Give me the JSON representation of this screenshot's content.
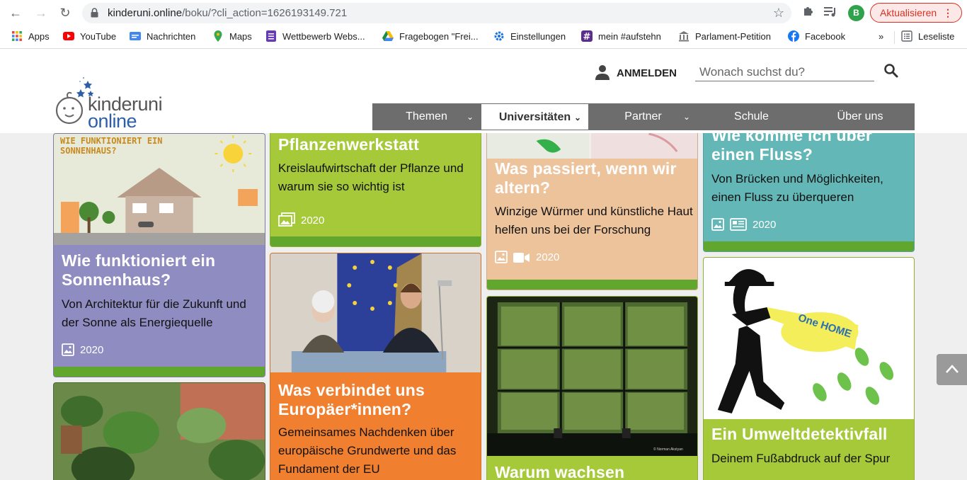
{
  "browser": {
    "url_host": "kinderuni.online",
    "url_path": "/boku/?cli_action=1626193149.721",
    "profile_initial": "B",
    "update_label": "Aktualisieren",
    "bookmarks": [
      {
        "label": "Apps",
        "icon": "apps-grid-icon",
        "color": "#4285f4"
      },
      {
        "label": "YouTube",
        "icon": "youtube-icon",
        "color": "#ff0000"
      },
      {
        "label": "Nachrichten",
        "icon": "google-news-icon",
        "color": "#4285f4"
      },
      {
        "label": "Maps",
        "icon": "maps-pin-icon",
        "color": "#34a853"
      },
      {
        "label": "Wettbewerb Webs...",
        "icon": "forms-icon",
        "color": "#673ab7"
      },
      {
        "label": "Fragebogen \"Frei...",
        "icon": "drive-icon",
        "color": "#fbbc04"
      },
      {
        "label": "Einstellungen",
        "icon": "settings-gear-icon",
        "color": "#1a73e8"
      },
      {
        "label": "mein #aufstehn",
        "icon": "hashtag-icon",
        "color": "#5b2d8f"
      },
      {
        "label": "Parlament-Petition",
        "icon": "parliament-icon",
        "color": "#777777"
      },
      {
        "label": "Facebook",
        "icon": "facebook-icon",
        "color": "#1877f2"
      }
    ],
    "more_label": "»",
    "reading_list_label": "Leseliste"
  },
  "header": {
    "logo_line1": "kinderuni",
    "logo_line2": "online",
    "login_label": "ANMELDEN",
    "search_placeholder": "Wonach suchst du?",
    "nav": [
      {
        "label": "Themen",
        "has_dropdown": true,
        "active": false
      },
      {
        "label": "Universitäten",
        "has_dropdown": true,
        "active": true
      },
      {
        "label": "Partner",
        "has_dropdown": true,
        "active": false
      },
      {
        "label": "Schule",
        "has_dropdown": false,
        "active": false
      },
      {
        "label": "Über uns",
        "has_dropdown": false,
        "active": false
      }
    ]
  },
  "cards": {
    "sonnenhaus": {
      "image_text": "WIE FUNKTIONIERT EIN SONNENHAUS?",
      "title": "Wie funktioniert ein Sonnenhaus?",
      "desc": "Von Architektur für die Zukunft und der Sonne als Energiequelle",
      "year": "2020",
      "color": "#8e8cc0"
    },
    "pflanzen": {
      "title": "Pflanzenwerkstatt",
      "desc": "Kreislaufwirtschaft der Pflanze und warum sie so wichtig ist",
      "year": "2020",
      "color": "#a6c93a"
    },
    "altern": {
      "title": "Was passiert, wenn wir altern?",
      "desc": "Winzige Würmer und künstliche Haut helfen uns bei der Forschung",
      "year": "2020",
      "color": "#edc39c"
    },
    "fluss": {
      "title": "Wie komme ich über einen Fluss?",
      "desc": "Von Brücken und Möglichkeiten, einen Fluss zu überqueren",
      "year": "2020",
      "color": "#63b7b6"
    },
    "europa": {
      "title": "Was verbindet uns Europäer*innen?",
      "desc": "Gemeinsames Nachdenken über europäische Grundwerte und das Fundament der EU",
      "color": "#f07f2f"
    },
    "wachsen": {
      "title": "Warum wachsen",
      "color": "#a6c93a",
      "photo_credit": "© Norman Akstyan"
    },
    "umwelt": {
      "image_text": "One HOME",
      "title": "Ein Umweltdetektivfall",
      "desc": "Deinem Fußabdruck auf der Spur",
      "color": "#a6c93a"
    }
  }
}
